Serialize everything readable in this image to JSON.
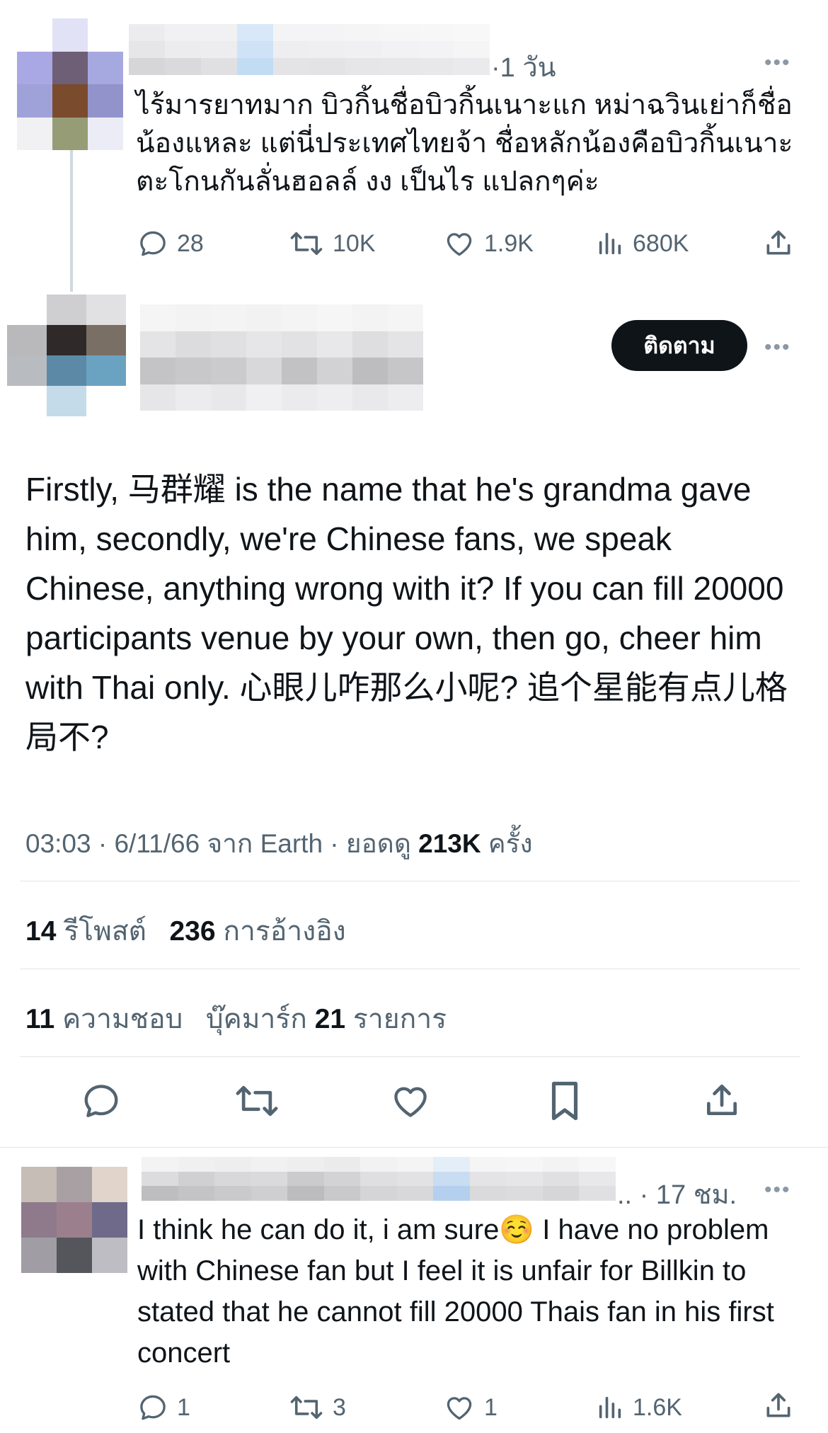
{
  "reply1": {
    "time": "·1 วัน",
    "text": "ไร้มารยาทมาก บิวกิ้นชื่อบิวกิ้นเนาะแก หม่าฉวินเย่าก็ชื่อน้องแหละ แต่นี่ประเทศไทยจ้า ชื่อหลักน้องคือบิวกิ้นเนาะ ตะโกนกันลั่นฮอลล์ งง เป็นไร แปลกๆค่ะ",
    "stats": {
      "replies": "28",
      "retweets": "10K",
      "likes": "1.9K",
      "views": "680K"
    }
  },
  "main": {
    "follow_label": "ติดตาม",
    "text": "Firstly, 马群耀 is the name that he's grandma gave him, secondly, we're Chinese fans, we speak Chinese, anything wrong with it? If you can fill 20000 participants venue by your own, then go, cheer him with Thai only. 心眼儿咋那么小呢? 追个星能有点儿格局不?",
    "meta_prefix": "03:03 · 6/11/66 จาก Earth · ยอดดู ",
    "views_num": "213K",
    "views_suffix": " ครั้ง",
    "retweets_num": "14",
    "retweets_label": " รีโพสต์",
    "quotes_num": "236",
    "quotes_label": " การอ้างอิง",
    "likes_num": "11",
    "likes_label": " ความชอบ",
    "bookmarks_label": "บุ๊คมาร์ก ",
    "bookmarks_num": "21",
    "bookmarks_suffix": " รายการ"
  },
  "reply2": {
    "time": ".. · 17 ชม.",
    "text_a": "I think he can do it, i am sure",
    "emoji": "☺️",
    "text_b": " I have no problem with Chinese fan but I feel it is unfair for Billkin to stated that he cannot fill 20000 Thais fan in his first concert",
    "stats": {
      "replies": "1",
      "retweets": "3",
      "likes": "1",
      "views": "1.6K"
    }
  },
  "icons": [
    "more-icon",
    "reply-icon",
    "retweet-icon",
    "like-icon",
    "views-icon",
    "share-icon",
    "bookmark-icon"
  ],
  "colors": {
    "text": "#0f1419",
    "muted": "#536471",
    "button": "#0f1419"
  }
}
